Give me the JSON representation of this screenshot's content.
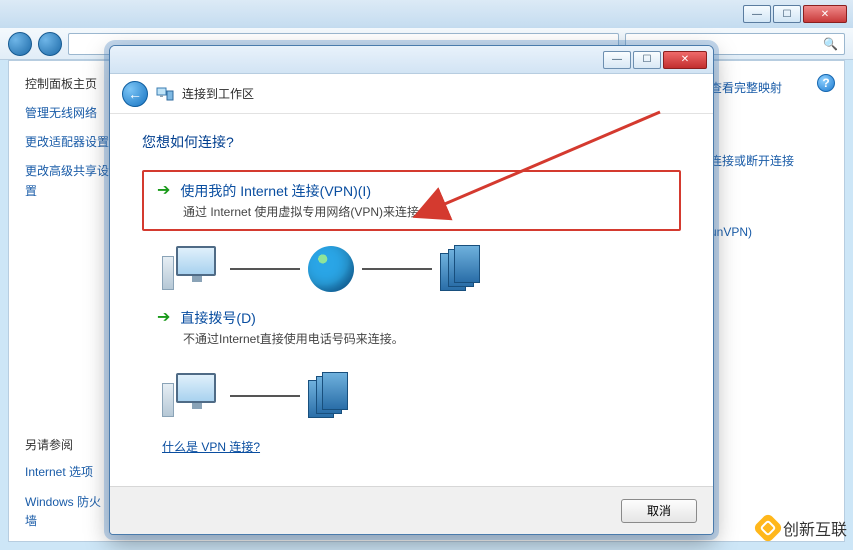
{
  "outer": {
    "sidebar": {
      "heading": "控制面板主页",
      "links": [
        "管理无线网络",
        "更改适配器设置",
        "更改高级共享设置"
      ],
      "see_also_heading": "另请参阅",
      "see_also": [
        "Internet 选项",
        "Windows 防火墙"
      ]
    },
    "right_links": [
      "查看完整映射",
      "连接或断开连接",
      "unVPN)"
    ],
    "help_glyph": "?"
  },
  "dialog": {
    "title": "连接到工作区",
    "question": "您想如何连接?",
    "options": [
      {
        "title": "使用我的 Internet 连接(VPN)(I)",
        "sub": "通过 Internet 使用虚拟专用网络(VPN)来连接"
      },
      {
        "title": "直接拨号(D)",
        "sub": "不通过Internet直接使用电话号码来连接。"
      }
    ],
    "vpn_link": "什么是 VPN 连接?",
    "cancel": "取消",
    "winbtn": {
      "min": "—",
      "max": "☐",
      "close": "✕"
    },
    "back_glyph": "←"
  },
  "watermark": {
    "text": "创新互联"
  }
}
